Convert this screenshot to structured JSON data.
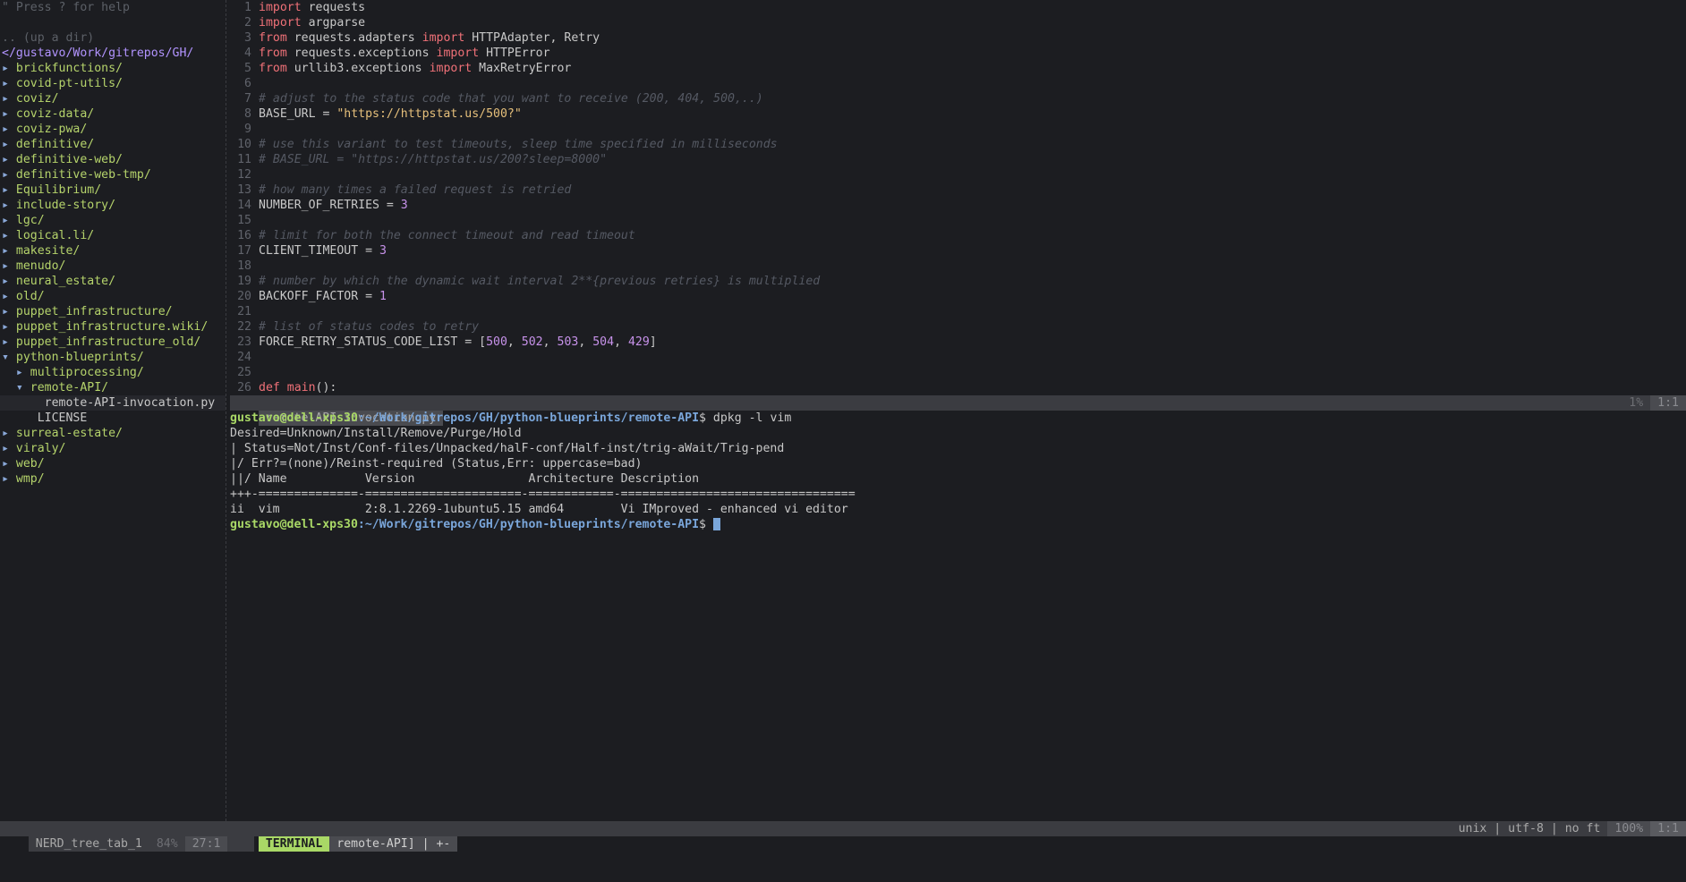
{
  "nerdtree": {
    "help": "\" Press ? for help",
    "up_dir": ".. (up a dir)",
    "root": "</gustavo/Work/gitrepos/GH/",
    "items": [
      {
        "arrow": "▸",
        "label": "brickfunctions/"
      },
      {
        "arrow": "▸",
        "label": "covid-pt-utils/"
      },
      {
        "arrow": "▸",
        "label": "coviz/"
      },
      {
        "arrow": "▸",
        "label": "coviz-data/"
      },
      {
        "arrow": "▸",
        "label": "coviz-pwa/"
      },
      {
        "arrow": "▸",
        "label": "definitive/"
      },
      {
        "arrow": "▸",
        "label": "definitive-web/"
      },
      {
        "arrow": "▸",
        "label": "definitive-web-tmp/"
      },
      {
        "arrow": "▸",
        "label": "Equilibrium/"
      },
      {
        "arrow": "▸",
        "label": "include-story/"
      },
      {
        "arrow": "▸",
        "label": "lgc/"
      },
      {
        "arrow": "▸",
        "label": "logical.li/"
      },
      {
        "arrow": "▸",
        "label": "makesite/"
      },
      {
        "arrow": "▸",
        "label": "menudo/"
      },
      {
        "arrow": "▸",
        "label": "neural_estate/"
      },
      {
        "arrow": "▸",
        "label": "old/"
      },
      {
        "arrow": "▸",
        "label": "puppet_infrastructure/"
      },
      {
        "arrow": "▸",
        "label": "puppet_infrastructure.wiki/"
      },
      {
        "arrow": "▸",
        "label": "puppet_infrastructure_old/"
      },
      {
        "arrow": "▾",
        "label": "python-blueprints/"
      },
      {
        "arrow": "  ▸",
        "label": "multiprocessing/"
      },
      {
        "arrow": "  ▾",
        "label": "remote-API/"
      },
      {
        "arrow": "     ",
        "label": "remote-API-invocation.py",
        "file": true,
        "selected": true
      },
      {
        "arrow": "   ",
        "label": " LICENSE",
        "file": true
      },
      {
        "arrow": "▸",
        "label": "surreal-estate/"
      },
      {
        "arrow": "▸",
        "label": "viraly/"
      },
      {
        "arrow": "▸",
        "label": "web/"
      },
      {
        "arrow": "▸",
        "label": "wmp/"
      }
    ]
  },
  "editor": {
    "lines": [
      {
        "n": "1",
        "toks": [
          [
            "kw",
            "import"
          ],
          [
            "pun",
            " requests"
          ]
        ]
      },
      {
        "n": "2",
        "toks": [
          [
            "kw",
            "import"
          ],
          [
            "pun",
            " argparse"
          ]
        ]
      },
      {
        "n": "3",
        "toks": [
          [
            "kw",
            "from"
          ],
          [
            "pun",
            " requests.adapters "
          ],
          [
            "kw",
            "import"
          ],
          [
            "pun",
            " HTTPAdapter, Retry"
          ]
        ]
      },
      {
        "n": "4",
        "toks": [
          [
            "kw",
            "from"
          ],
          [
            "pun",
            " requests.exceptions "
          ],
          [
            "kw",
            "import"
          ],
          [
            "pun",
            " HTTPError"
          ]
        ]
      },
      {
        "n": "5",
        "toks": [
          [
            "kw",
            "from"
          ],
          [
            "pun",
            " urllib3.exceptions "
          ],
          [
            "kw",
            "import"
          ],
          [
            "pun",
            " MaxRetryError"
          ]
        ]
      },
      {
        "n": "6",
        "toks": []
      },
      {
        "n": "7",
        "toks": [
          [
            "cm",
            "# adjust to the status code that you want to receive (200, 404, 500,..)"
          ]
        ]
      },
      {
        "n": "8",
        "toks": [
          [
            "pun",
            "BASE_URL = "
          ],
          [
            "str",
            "\"https://httpstat.us/500?\""
          ]
        ]
      },
      {
        "n": "9",
        "toks": []
      },
      {
        "n": "10",
        "toks": [
          [
            "cm",
            "# use this variant to test timeouts, sleep time specified in milliseconds"
          ]
        ]
      },
      {
        "n": "11",
        "toks": [
          [
            "cm",
            "# BASE_URL = \"https://httpstat.us/200?sleep=8000\""
          ]
        ]
      },
      {
        "n": "12",
        "toks": []
      },
      {
        "n": "13",
        "toks": [
          [
            "cm",
            "# how many times a failed request is retried"
          ]
        ]
      },
      {
        "n": "14",
        "toks": [
          [
            "pun",
            "NUMBER_OF_RETRIES = "
          ],
          [
            "num",
            "3"
          ]
        ]
      },
      {
        "n": "15",
        "toks": []
      },
      {
        "n": "16",
        "toks": [
          [
            "cm",
            "# limit for both the connect timeout and read timeout"
          ]
        ]
      },
      {
        "n": "17",
        "toks": [
          [
            "pun",
            "CLIENT_TIMEOUT = "
          ],
          [
            "num",
            "3"
          ]
        ]
      },
      {
        "n": "18",
        "toks": []
      },
      {
        "n": "19",
        "toks": [
          [
            "cm",
            "# number by which the dynamic wait interval 2**{previous retries} is multiplied"
          ]
        ]
      },
      {
        "n": "20",
        "toks": [
          [
            "pun",
            "BACKOFF_FACTOR = "
          ],
          [
            "num",
            "1"
          ]
        ]
      },
      {
        "n": "21",
        "toks": []
      },
      {
        "n": "22",
        "toks": [
          [
            "cm",
            "# list of status codes to retry"
          ]
        ]
      },
      {
        "n": "23",
        "toks": [
          [
            "pun",
            "FORCE_RETRY_STATUS_CODE_LIST = ["
          ],
          [
            "num",
            "500"
          ],
          [
            "pun",
            ", "
          ],
          [
            "num",
            "502"
          ],
          [
            "pun",
            ", "
          ],
          [
            "num",
            "503"
          ],
          [
            "pun",
            ", "
          ],
          [
            "num",
            "504"
          ],
          [
            "pun",
            ", "
          ],
          [
            "num",
            "429"
          ],
          [
            "pun",
            "]"
          ]
        ]
      },
      {
        "n": "24",
        "toks": []
      },
      {
        "n": "25",
        "toks": []
      },
      {
        "n": "26",
        "toks": [
          [
            "kw",
            "def"
          ],
          [
            "pun",
            " "
          ],
          [
            "kw",
            "main"
          ],
          [
            "pun",
            "():"
          ]
        ]
      }
    ]
  },
  "editor_status": {
    "filename": "remote-API-invocation.py",
    "percent": "1%",
    "position": "1:1"
  },
  "terminal": {
    "prompt_user": "gustavo@dell-xps30",
    "prompt_path": ":~/Work/gitrepos/GH/python-blueprints/remote-API",
    "prompt_sym": "$ ",
    "command": "dpkg -l vim",
    "output": [
      "Desired=Unknown/Install/Remove/Purge/Hold",
      "| Status=Not/Inst/Conf-files/Unpacked/halF-conf/Half-inst/trig-aWait/Trig-pend",
      "|/ Err?=(none)/Reinst-required (Status,Err: uppercase=bad)",
      "||/ Name           Version                Architecture Description",
      "+++-==============-======================-============-=================================",
      "ii  vim            2:8.1.2269-1ubuntu5.15 amd64        Vi IMproved - enhanced vi editor"
    ]
  },
  "bottom_status": {
    "nerd_name": "NERD_tree_tab_1",
    "nerd_percent": "84%",
    "nerd_position": "27:1",
    "mode": "TERMINAL",
    "term_name": "remote-API] | +-",
    "encoding": "unix | utf-8 | no ft",
    "percent": "100%",
    "position": "1:1"
  }
}
